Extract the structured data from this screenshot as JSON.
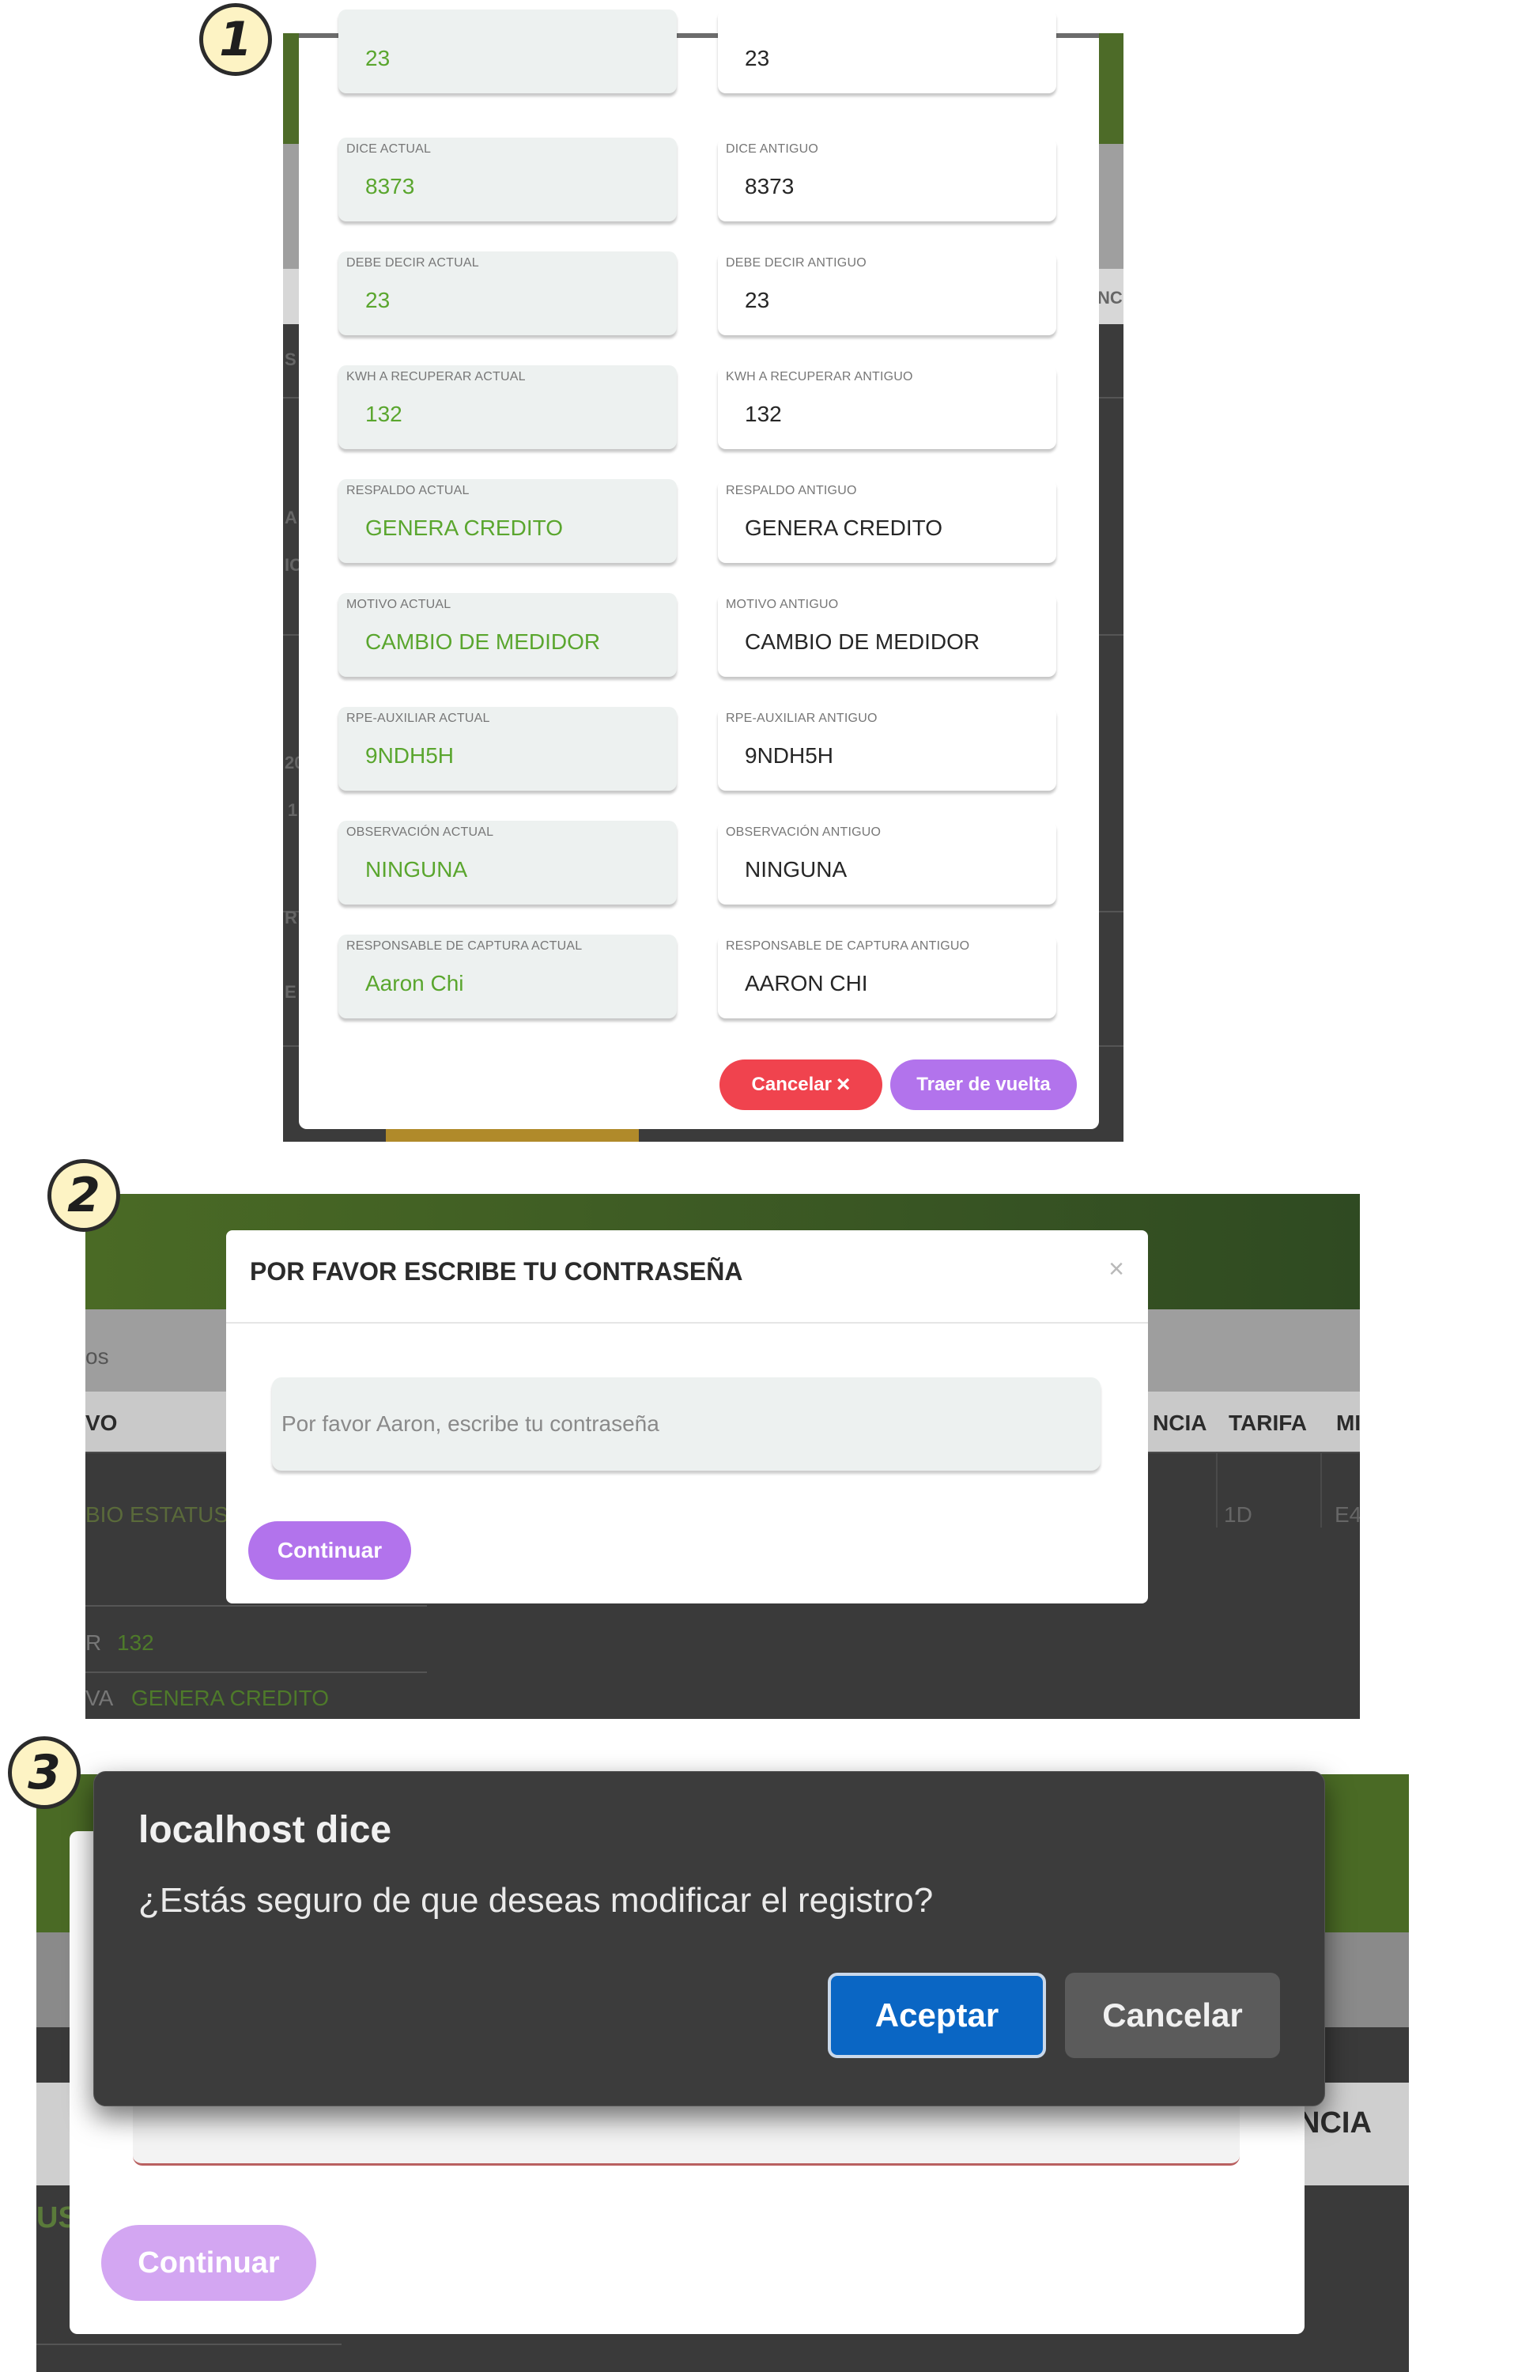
{
  "steps": [
    "1",
    "2",
    "3"
  ],
  "step1": {
    "current_fields": [
      {
        "label": "",
        "value": "23"
      },
      {
        "label": "DICE ACTUAL",
        "value": "8373"
      },
      {
        "label": "DEBE DECIR ACTUAL",
        "value": "23"
      },
      {
        "label": "KWH A RECUPERAR ACTUAL",
        "value": "132"
      },
      {
        "label": "RESPALDO ACTUAL",
        "value": "GENERA CREDITO"
      },
      {
        "label": "MOTIVO ACTUAL",
        "value": "CAMBIO DE MEDIDOR"
      },
      {
        "label": "RPE-AUXILIAR ACTUAL",
        "value": "9NDH5H"
      },
      {
        "label": "OBSERVACIÓN ACTUAL",
        "value": "NINGUNA"
      },
      {
        "label": "RESPONSABLE DE CAPTURA ACTUAL",
        "value": "Aaron Chi"
      }
    ],
    "old_fields": [
      {
        "label": "",
        "value": "23"
      },
      {
        "label": "DICE ANTIGUO",
        "value": "8373"
      },
      {
        "label": "DEBE DECIR ANTIGUO",
        "value": "23"
      },
      {
        "label": "KWH A RECUPERAR ANTIGUO",
        "value": "132"
      },
      {
        "label": "RESPALDO ANTIGUO",
        "value": "GENERA CREDITO"
      },
      {
        "label": "MOTIVO ANTIGUO",
        "value": "CAMBIO DE MEDIDOR"
      },
      {
        "label": "RPE-AUXILIAR ANTIGUO",
        "value": "9NDH5H"
      },
      {
        "label": "OBSERVACIÓN ANTIGUO",
        "value": "NINGUNA"
      },
      {
        "label": "RESPONSABLE DE CAPTURA ANTIGUO",
        "value": "AARON CHI"
      }
    ],
    "cancel_label": "Cancelar",
    "cancel_icon": "×",
    "back_label": "Traer de vuelta",
    "background_fragments": [
      "S",
      "A",
      "IC",
      "20",
      "1",
      "R",
      "E",
      "NC"
    ]
  },
  "step2": {
    "title": "POR FAVOR ESCRIBE TU CONTRASEÑA",
    "close_icon": "×",
    "password_placeholder": "Por favor Aaron, escribe tu contraseña",
    "continue_label": "Continuar",
    "background": {
      "tab_fragment": "os",
      "col_fragment": "VO",
      "col_ncia": "NCIA",
      "col_tarifa": "TARIFA",
      "col_mi": "MI",
      "row_status": "BIO ESTATUS",
      "row_tarifa": "1D",
      "row_e4": "E4",
      "detail1_key": "R",
      "detail1_val": "132",
      "detail2_key": "VA",
      "detail2_val": "GENERA CREDITO"
    }
  },
  "step3": {
    "dialog_title": "localhost dice",
    "dialog_message": "¿Estás seguro de que deseas modificar el registro?",
    "accept_label": "Aceptar",
    "cancel_label": "Cancelar",
    "continue_label": "Continuar",
    "background": {
      "col_ncia": "NCIA",
      "side_fragment": "US"
    }
  },
  "colors": {
    "green_value": "#5aa62e",
    "purple_button": "#b273ec",
    "red_button": "#f0434e",
    "accept_blue": "#0a66c4",
    "header_green": "#4d6b28"
  }
}
